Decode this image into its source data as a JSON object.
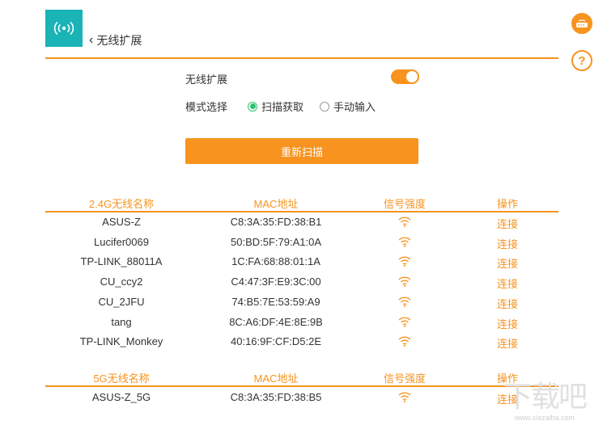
{
  "header": {
    "back_label": "无线扩展"
  },
  "settings": {
    "wireless_label": "无线扩展",
    "wireless_on": true,
    "mode_label": "模式选择",
    "mode_options": [
      {
        "label": "扫描获取",
        "selected": true
      },
      {
        "label": "手动输入",
        "selected": false
      }
    ],
    "rescan_label": "重新扫描"
  },
  "table24": {
    "headers": [
      "2.4G无线名称",
      "MAC地址",
      "信号强度",
      "操作"
    ],
    "rows": [
      {
        "name": "ASUS-Z",
        "mac": "C8:3A:35:FD:38:B1",
        "action": "连接"
      },
      {
        "name": "Lucifer0069",
        "mac": "50:BD:5F:79:A1:0A",
        "action": "连接"
      },
      {
        "name": "TP-LINK_88011A",
        "mac": "1C:FA:68:88:01:1A",
        "action": "连接"
      },
      {
        "name": "CU_ccy2",
        "mac": "C4:47:3F:E9:3C:00",
        "action": "连接"
      },
      {
        "name": "CU_2JFU",
        "mac": "74:B5:7E:53:59:A9",
        "action": "连接"
      },
      {
        "name": "tang",
        "mac": "8C:A6:DF:4E:8E:9B",
        "action": "连接"
      },
      {
        "name": "TP-LINK_Monkey",
        "mac": "40:16:9F:CF:D5:2E",
        "action": "连接"
      }
    ]
  },
  "table5": {
    "headers": [
      "5G无线名称",
      "MAC地址",
      "信号强度",
      "操作"
    ],
    "rows": [
      {
        "name": "ASUS-Z_5G",
        "mac": "C8:3A:35:FD:38:B5",
        "action": "连接"
      }
    ]
  },
  "watermark": {
    "main": "下载吧",
    "sub": "www.xiazaiba.com"
  },
  "colors": {
    "accent": "#f7931e",
    "teal": "#1ab3b6",
    "radio_selected": "#2fbf71"
  },
  "icons": {
    "header": "wireless-broadcast-icon",
    "side_top": "router-icon",
    "side_bottom": "help-icon",
    "signal": "wifi-signal-icon"
  }
}
